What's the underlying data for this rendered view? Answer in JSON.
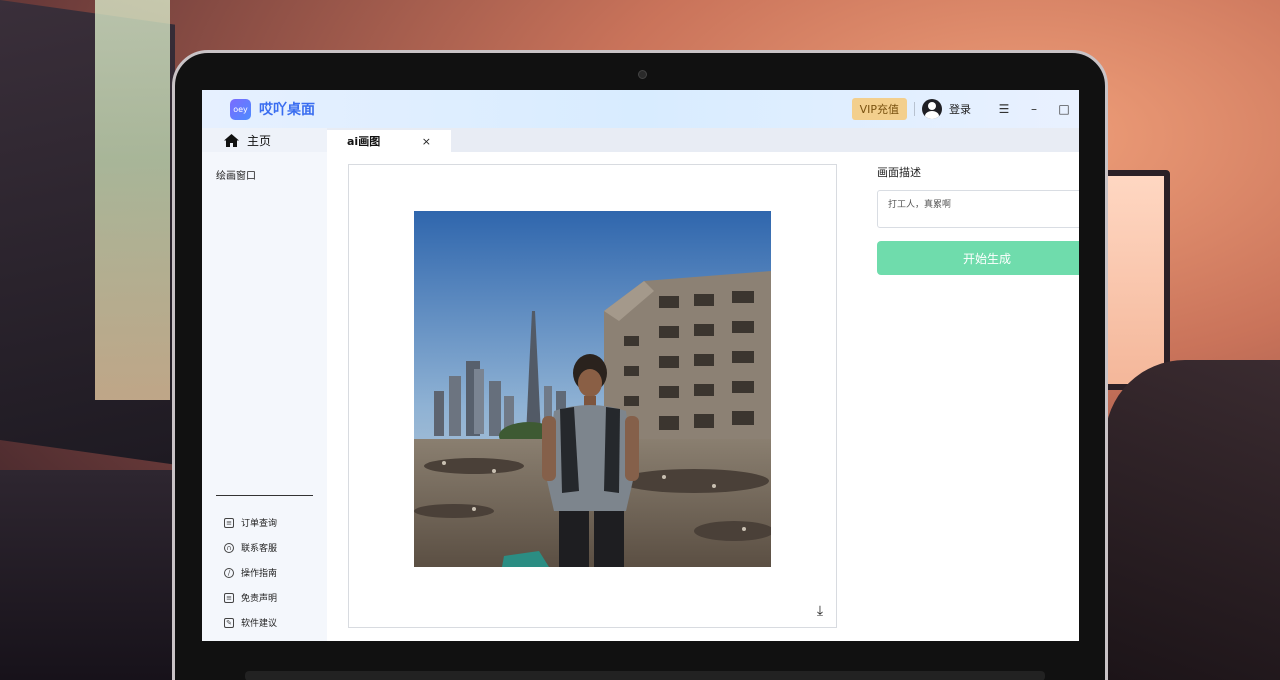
{
  "app": {
    "name": "哎吖桌面",
    "logo_text": "oey",
    "vip_label": "VIP充值",
    "login_label": "登录",
    "menu_icon": "☰",
    "minimize_icon": "–",
    "maximize_icon": "□"
  },
  "sidebar": {
    "home_label": "主页",
    "main_item": "绘画窗口",
    "links": [
      {
        "label": "订单查询",
        "icon": "order-icon"
      },
      {
        "label": "联系客服",
        "icon": "headset-icon"
      },
      {
        "label": "操作指南",
        "icon": "compass-icon"
      },
      {
        "label": "免责声明",
        "icon": "document-icon"
      },
      {
        "label": "软件建议",
        "icon": "edit-icon"
      }
    ]
  },
  "tabs": [
    {
      "label": "ai画图",
      "close": "×"
    }
  ],
  "canvas": {
    "image_description": "AI generated photo",
    "download_icon": "⤓"
  },
  "right_panel": {
    "desc_label": "画面描述",
    "desc_value": "打工人，真累啊",
    "generate_label": "开始生成"
  },
  "colors": {
    "accent": "#3a6df0",
    "vip_bg": "#f3cf8d",
    "generate_btn": "#6fdcac"
  }
}
